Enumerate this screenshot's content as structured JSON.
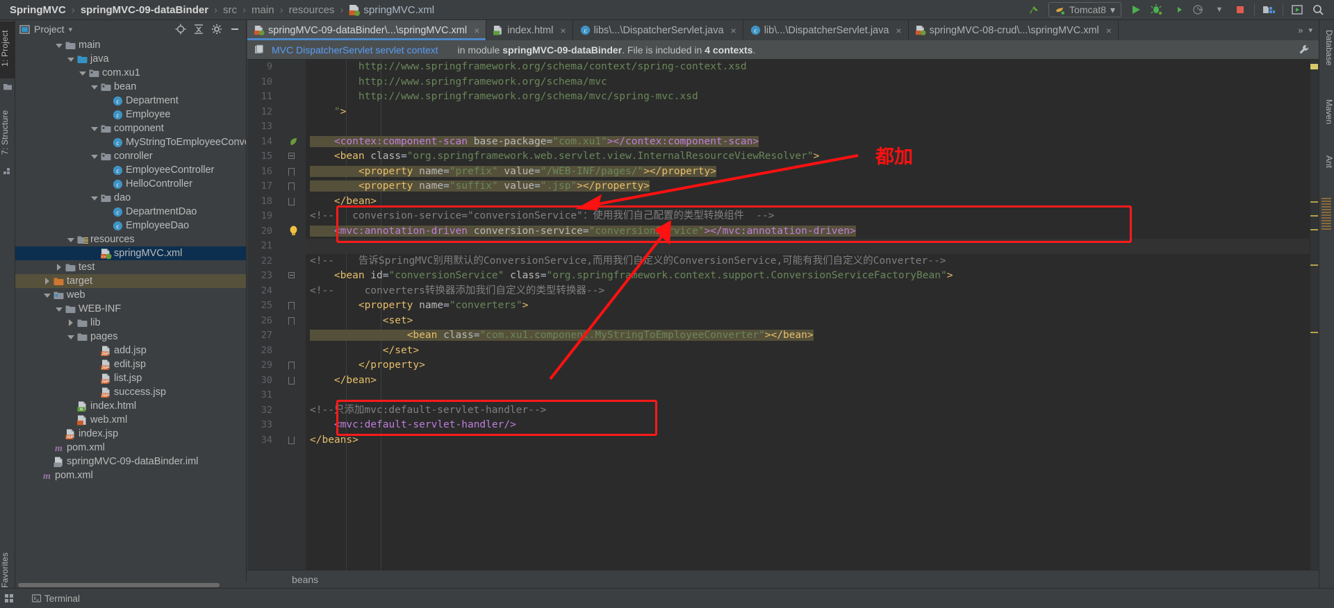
{
  "breadcrumb": {
    "items": [
      {
        "label": "SpringMVC",
        "style": "bold"
      },
      {
        "label": "springMVC-09-dataBinder",
        "style": "bold"
      },
      {
        "label": "src",
        "style": "dim"
      },
      {
        "label": "main",
        "style": "dim"
      },
      {
        "label": "resources",
        "style": "dim"
      },
      {
        "label": "springMVC.xml",
        "style": "file",
        "icon": "xml-spring-file-icon"
      }
    ],
    "separator": "›"
  },
  "toolbar": {
    "update_label": "update-project-icon",
    "run_config": {
      "name": "Tomcat8",
      "icon": "tomcat-icon",
      "chevron": "▾"
    },
    "buttons": [
      {
        "name": "run-button",
        "icon": "play-icon"
      },
      {
        "name": "debug-button",
        "icon": "bug-icon"
      },
      {
        "name": "run-with-coverage-button",
        "icon": "coverage-icon"
      },
      {
        "name": "profiler-button",
        "icon": "profiler-icon"
      },
      {
        "name": "stop-button",
        "icon": "stop-icon"
      },
      {
        "name": "project-structure-button",
        "icon": "project-structure-icon"
      },
      {
        "name": "select-in-button",
        "icon": "select-in-icon"
      },
      {
        "name": "search-everywhere-button",
        "icon": "search-icon"
      }
    ]
  },
  "left_strip": {
    "project_tab": "1: Project",
    "structure_tab": "7: Structure",
    "favorites_tab": "2: Favorites"
  },
  "right_strip": {
    "database_tab": "Database",
    "maven_tab": "Maven",
    "ant_tab": "Ant"
  },
  "project_panel": {
    "title": "Project",
    "chevron": "▾",
    "locate_icon": "locate-target-icon",
    "collapse_icon": "collapse-all-icon",
    "settings_icon": "gear-icon",
    "hide_icon": "hide-panel-icon",
    "tree": [
      {
        "label": "main",
        "indent": 3,
        "arrow": "down",
        "icon": "folder",
        "tint": "grey"
      },
      {
        "label": "java",
        "indent": 4,
        "arrow": "down",
        "icon": "folder",
        "tint": "blue"
      },
      {
        "label": "com.xu1",
        "indent": 5,
        "arrow": "down",
        "icon": "package",
        "tint": "grey"
      },
      {
        "label": "bean",
        "indent": 6,
        "arrow": "down",
        "icon": "package",
        "tint": "grey"
      },
      {
        "label": "Department",
        "indent": 7,
        "arrow": "none",
        "icon": "class",
        "tint": "blue"
      },
      {
        "label": "Employee",
        "indent": 7,
        "arrow": "none",
        "icon": "class",
        "tint": "blue"
      },
      {
        "label": "component",
        "indent": 6,
        "arrow": "down",
        "icon": "package",
        "tint": "grey"
      },
      {
        "label": "MyStringToEmployeeConve",
        "indent": 7,
        "arrow": "none",
        "icon": "class",
        "tint": "blue"
      },
      {
        "label": "conroller",
        "indent": 6,
        "arrow": "down",
        "icon": "package",
        "tint": "grey"
      },
      {
        "label": "EmployeeController",
        "indent": 7,
        "arrow": "none",
        "icon": "class",
        "tint": "blue"
      },
      {
        "label": "HelloController",
        "indent": 7,
        "arrow": "none",
        "icon": "class",
        "tint": "blue"
      },
      {
        "label": "dao",
        "indent": 6,
        "arrow": "down",
        "icon": "package",
        "tint": "grey"
      },
      {
        "label": "DepartmentDao",
        "indent": 7,
        "arrow": "none",
        "icon": "class",
        "tint": "blue"
      },
      {
        "label": "EmployeeDao",
        "indent": 7,
        "arrow": "none",
        "icon": "class",
        "tint": "blue"
      },
      {
        "label": "resources",
        "indent": 4,
        "arrow": "down",
        "icon": "resource-folder",
        "tint": "grey"
      },
      {
        "label": "springMVC.xml",
        "indent": 6,
        "arrow": "none",
        "icon": "xml-spring",
        "tint": "grey",
        "state": "selected"
      },
      {
        "label": "test",
        "indent": 3,
        "arrow": "right",
        "icon": "folder",
        "tint": "grey"
      },
      {
        "label": "target",
        "indent": 2,
        "arrow": "right",
        "icon": "folder",
        "tint": "orange",
        "state": "excluded"
      },
      {
        "label": "web",
        "indent": 2,
        "arrow": "down",
        "icon": "web-folder",
        "tint": "grey"
      },
      {
        "label": "WEB-INF",
        "indent": 3,
        "arrow": "down",
        "icon": "folder",
        "tint": "grey"
      },
      {
        "label": "lib",
        "indent": 4,
        "arrow": "right",
        "icon": "folder",
        "tint": "grey"
      },
      {
        "label": "pages",
        "indent": 4,
        "arrow": "down",
        "icon": "folder",
        "tint": "grey"
      },
      {
        "label": "add.jsp",
        "indent": 6,
        "arrow": "none",
        "icon": "jsp",
        "tint": "grey"
      },
      {
        "label": "edit.jsp",
        "indent": 6,
        "arrow": "none",
        "icon": "jsp",
        "tint": "grey"
      },
      {
        "label": "list.jsp",
        "indent": 6,
        "arrow": "none",
        "icon": "jsp",
        "tint": "grey"
      },
      {
        "label": "success.jsp",
        "indent": 6,
        "arrow": "none",
        "icon": "jsp",
        "tint": "grey"
      },
      {
        "label": "index.html",
        "indent": 4,
        "arrow": "none",
        "icon": "html",
        "tint": "grey"
      },
      {
        "label": "web.xml",
        "indent": 4,
        "arrow": "none",
        "icon": "xml",
        "tint": "grey"
      },
      {
        "label": "index.jsp",
        "indent": 3,
        "arrow": "none",
        "icon": "jsp",
        "tint": "grey"
      },
      {
        "label": "pom.xml",
        "indent": 2,
        "arrow": "none",
        "icon": "maven",
        "tint": "purple"
      },
      {
        "label": "springMVC-09-dataBinder.iml",
        "indent": 2,
        "arrow": "none",
        "icon": "iml",
        "tint": "grey"
      },
      {
        "label": "pom.xml",
        "indent": 1,
        "arrow": "none",
        "icon": "maven",
        "tint": "purple"
      }
    ]
  },
  "editor_tabs": [
    {
      "label": "springMVC-09-dataBinder\\...\\springMVC.xml",
      "icon": "xml-spring-file-icon",
      "active": true,
      "close": "×"
    },
    {
      "label": "index.html",
      "icon": "html-file-icon",
      "active": false,
      "close": "×"
    },
    {
      "label": "libs\\...\\DispatcherServlet.java",
      "icon": "java-class-icon",
      "active": false,
      "close": "×"
    },
    {
      "label": "lib\\...\\DispatcherServlet.java",
      "icon": "java-class-icon",
      "active": false,
      "close": "×"
    },
    {
      "label": "springMVC-08-crud\\...\\springMVC.xml",
      "icon": "xml-spring-file-icon",
      "active": false,
      "close": "×"
    }
  ],
  "editor_tabs_overflow": {
    "chevron": "▾",
    "more": "»"
  },
  "notification": {
    "icon": "servlet-context-icon",
    "link": "MVC DispatcherServlet servlet context",
    "prefix": "in module ",
    "module": "springMVC-09-dataBinder",
    "middle": ". File is included in ",
    "contexts": "4 contexts",
    "suffix": ".",
    "settings_icon": "wrench-icon"
  },
  "code": {
    "first_line_number": 9,
    "lines": [
      {
        "n": 9,
        "tokens": [
          {
            "t": "        ",
            "c": "pun"
          },
          {
            "t": "http://www.springframework.org/schema/context/spring-context.xsd",
            "c": "str"
          }
        ]
      },
      {
        "n": 10,
        "tokens": [
          {
            "t": "        ",
            "c": "pun"
          },
          {
            "t": "http://www.springframework.org/schema/mvc",
            "c": "str"
          }
        ]
      },
      {
        "n": 11,
        "tokens": [
          {
            "t": "        ",
            "c": "pun"
          },
          {
            "t": "http://www.springframework.org/schema/mvc/spring-mvc.xsd",
            "c": "str"
          }
        ]
      },
      {
        "n": 12,
        "tokens": [
          {
            "t": "    ",
            "c": "pun"
          },
          {
            "t": "\"",
            "c": "str"
          },
          {
            "t": ">",
            "c": "tag"
          }
        ]
      },
      {
        "n": 13,
        "tokens": []
      },
      {
        "n": 14,
        "hl": true,
        "tokens": [
          {
            "t": "    ",
            "c": "pun"
          },
          {
            "t": "<contex:component-scan",
            "c": "tagns"
          },
          {
            "t": " base-package",
            "c": "attr"
          },
          {
            "t": "=",
            "c": "pun"
          },
          {
            "t": "\"com.xu1\"",
            "c": "str"
          },
          {
            "t": ">",
            "c": "tagns"
          },
          {
            "t": "</contex:component-scan>",
            "c": "tagns"
          }
        ]
      },
      {
        "n": 15,
        "tokens": [
          {
            "t": "    ",
            "c": "pun"
          },
          {
            "t": "<bean",
            "c": "tag"
          },
          {
            "t": " class",
            "c": "attr"
          },
          {
            "t": "=",
            "c": "pun"
          },
          {
            "t": "\"org.springframework.web.servlet.view.InternalResourceViewResolver\"",
            "c": "str"
          },
          {
            "t": ">",
            "c": "tag"
          }
        ]
      },
      {
        "n": 16,
        "hl": true,
        "tokens": [
          {
            "t": "        ",
            "c": "pun"
          },
          {
            "t": "<property",
            "c": "tag"
          },
          {
            "t": " name",
            "c": "attr"
          },
          {
            "t": "=",
            "c": "pun"
          },
          {
            "t": "\"prefix\"",
            "c": "str"
          },
          {
            "t": " value",
            "c": "attr"
          },
          {
            "t": "=",
            "c": "pun"
          },
          {
            "t": "\"/WEB-INF/pages/\"",
            "c": "str"
          },
          {
            "t": ">",
            "c": "tag"
          },
          {
            "t": "</property>",
            "c": "tag"
          }
        ]
      },
      {
        "n": 17,
        "hl": true,
        "tokens": [
          {
            "t": "        ",
            "c": "pun"
          },
          {
            "t": "<property",
            "c": "tag"
          },
          {
            "t": " name",
            "c": "attr"
          },
          {
            "t": "=",
            "c": "pun"
          },
          {
            "t": "\"suffix\"",
            "c": "str"
          },
          {
            "t": " value",
            "c": "attr"
          },
          {
            "t": "=",
            "c": "pun"
          },
          {
            "t": "\".jsp\"",
            "c": "str"
          },
          {
            "t": ">",
            "c": "tag"
          },
          {
            "t": "</property>",
            "c": "tag"
          }
        ]
      },
      {
        "n": 18,
        "tokens": [
          {
            "t": "    ",
            "c": "pun"
          },
          {
            "t": "</bean>",
            "c": "tag"
          }
        ]
      },
      {
        "n": 19,
        "tokens": [
          {
            "t": "",
            "c": "pun"
          },
          {
            "t": "<!--   conversion-service=\"conversionService\"：使用我们自己配置的类型转换组件  -->",
            "c": "cmt"
          }
        ]
      },
      {
        "n": 20,
        "hl": true,
        "bulb": true,
        "tokens": [
          {
            "t": "    ",
            "c": "pun"
          },
          {
            "t": "<mvc:annotation-driven",
            "c": "tagns"
          },
          {
            "t": " conversion-service",
            "c": "attr"
          },
          {
            "t": "=",
            "c": "pun"
          },
          {
            "t": "\"conversionService\"",
            "c": "str"
          },
          {
            "t": ">",
            "c": "tagns"
          },
          {
            "t": "</mvc:annotation-driven>",
            "c": "tagns"
          }
        ]
      },
      {
        "n": 21,
        "cur": true,
        "tokens": []
      },
      {
        "n": 22,
        "tokens": [
          {
            "t": "",
            "c": "pun"
          },
          {
            "t": "<!--    告诉SpringMVC别用默认的ConversionService,而用我们自定义的ConversionService,可能有我们自定义的Converter-->",
            "c": "cmt"
          }
        ]
      },
      {
        "n": 23,
        "tokens": [
          {
            "t": "    ",
            "c": "pun"
          },
          {
            "t": "<bean",
            "c": "tag"
          },
          {
            "t": " id",
            "c": "attr"
          },
          {
            "t": "=",
            "c": "pun"
          },
          {
            "t": "\"conversionService\"",
            "c": "str"
          },
          {
            "t": " class",
            "c": "attr"
          },
          {
            "t": "=",
            "c": "pun"
          },
          {
            "t": "\"org.springframework.context.support.ConversionServiceFactoryBean\"",
            "c": "str"
          },
          {
            "t": ">",
            "c": "tag"
          }
        ]
      },
      {
        "n": 24,
        "tokens": [
          {
            "t": "",
            "c": "pun"
          },
          {
            "t": "<!--     converters转换器添加我们自定义的类型转换器-->",
            "c": "cmt"
          }
        ]
      },
      {
        "n": 25,
        "tokens": [
          {
            "t": "        ",
            "c": "pun"
          },
          {
            "t": "<property",
            "c": "tag"
          },
          {
            "t": " name",
            "c": "attr"
          },
          {
            "t": "=",
            "c": "pun"
          },
          {
            "t": "\"converters\"",
            "c": "str"
          },
          {
            "t": ">",
            "c": "tag"
          }
        ]
      },
      {
        "n": 26,
        "tokens": [
          {
            "t": "            ",
            "c": "pun"
          },
          {
            "t": "<set>",
            "c": "tag"
          }
        ]
      },
      {
        "n": 27,
        "hl": true,
        "tokens": [
          {
            "t": "                ",
            "c": "pun"
          },
          {
            "t": "<bean",
            "c": "tag"
          },
          {
            "t": " class",
            "c": "attr"
          },
          {
            "t": "=",
            "c": "pun"
          },
          {
            "t": "\"com.xu1.component.MyStringToEmployeeConverter\"",
            "c": "str"
          },
          {
            "t": ">",
            "c": "tag"
          },
          {
            "t": "</bean>",
            "c": "tag"
          }
        ]
      },
      {
        "n": 28,
        "tokens": [
          {
            "t": "            ",
            "c": "pun"
          },
          {
            "t": "</set>",
            "c": "tag"
          }
        ]
      },
      {
        "n": 29,
        "tokens": [
          {
            "t": "        ",
            "c": "pun"
          },
          {
            "t": "</property>",
            "c": "tag"
          }
        ]
      },
      {
        "n": 30,
        "tokens": [
          {
            "t": "    ",
            "c": "pun"
          },
          {
            "t": "</bean>",
            "c": "tag"
          }
        ]
      },
      {
        "n": 31,
        "tokens": []
      },
      {
        "n": 32,
        "tokens": [
          {
            "t": "",
            "c": "pun"
          },
          {
            "t": "<!--只添加mvc:default-servlet-handler-->",
            "c": "cmt"
          }
        ]
      },
      {
        "n": 33,
        "tokens": [
          {
            "t": "    ",
            "c": "pun"
          },
          {
            "t": "<mvc:default-servlet-handler/>",
            "c": "tagns"
          }
        ]
      },
      {
        "n": 34,
        "tokens": [
          {
            "t": "",
            "c": "pun"
          },
          {
            "t": "</beans>",
            "c": "tag"
          }
        ]
      }
    ]
  },
  "annotations": {
    "arrow_label": "都加",
    "color": "#ff1111",
    "boxes": [
      "conversion-service-box",
      "default-servlet-handler-box"
    ]
  },
  "bottom_breadcrumb": {
    "path": "beans"
  },
  "status_bar": {
    "tabs": [
      {
        "label": "Terminal",
        "icon": "terminal-icon"
      }
    ]
  }
}
